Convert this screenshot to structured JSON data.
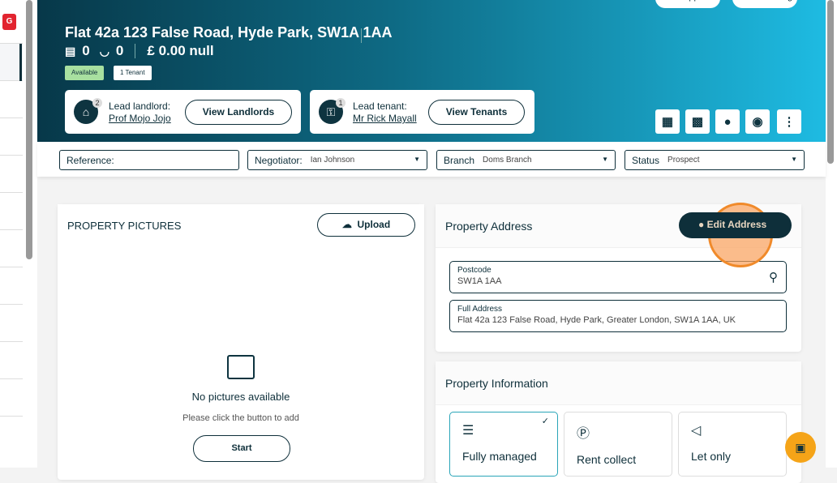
{
  "sidebar": {
    "badge": "G"
  },
  "header": {
    "pills": [
      "Appraisal",
      "Working"
    ],
    "title": "Flat 42a 123 False Road, Hyde Park, SW1A 1AA",
    "bedrooms": "0",
    "bathrooms": "0",
    "price": "£ 0.00 null",
    "badges": {
      "available": "Available",
      "tenants": "1 Tenant"
    },
    "landlord": {
      "count": "2",
      "label": "Lead landlord:",
      "name": "Prof Mojo Jojo",
      "button": "View Landlords"
    },
    "tenant": {
      "count": "1",
      "label": "Lead tenant:",
      "name": "Mr Rick Mayall",
      "button": "View Tenants"
    }
  },
  "filters": {
    "reference": {
      "label": "Reference:",
      "value": ""
    },
    "negotiator": {
      "label": "Negotiator:",
      "value": "Ian Johnson"
    },
    "branch": {
      "label": "Branch",
      "value": "Doms Branch"
    },
    "status": {
      "label": "Status",
      "value": "Prospect"
    }
  },
  "pictures": {
    "title": "PROPERTY PICTURES",
    "upload": "Upload",
    "empty_title": "No pictures available",
    "empty_sub": "Please click the button to add",
    "start": "Start"
  },
  "address": {
    "title": "Property Address",
    "edit": "Edit Address",
    "postcode_label": "Postcode",
    "postcode": "SW1A 1AA",
    "full_label": "Full Address",
    "full": "Flat 42a 123 False Road, Hyde Park, Greater London, SW1A 1AA, UK"
  },
  "info": {
    "title": "Property Information",
    "options": [
      {
        "label": "Fully managed",
        "selected": true
      },
      {
        "label": "Rent collect",
        "selected": false
      },
      {
        "label": "Let only",
        "selected": false
      }
    ]
  }
}
